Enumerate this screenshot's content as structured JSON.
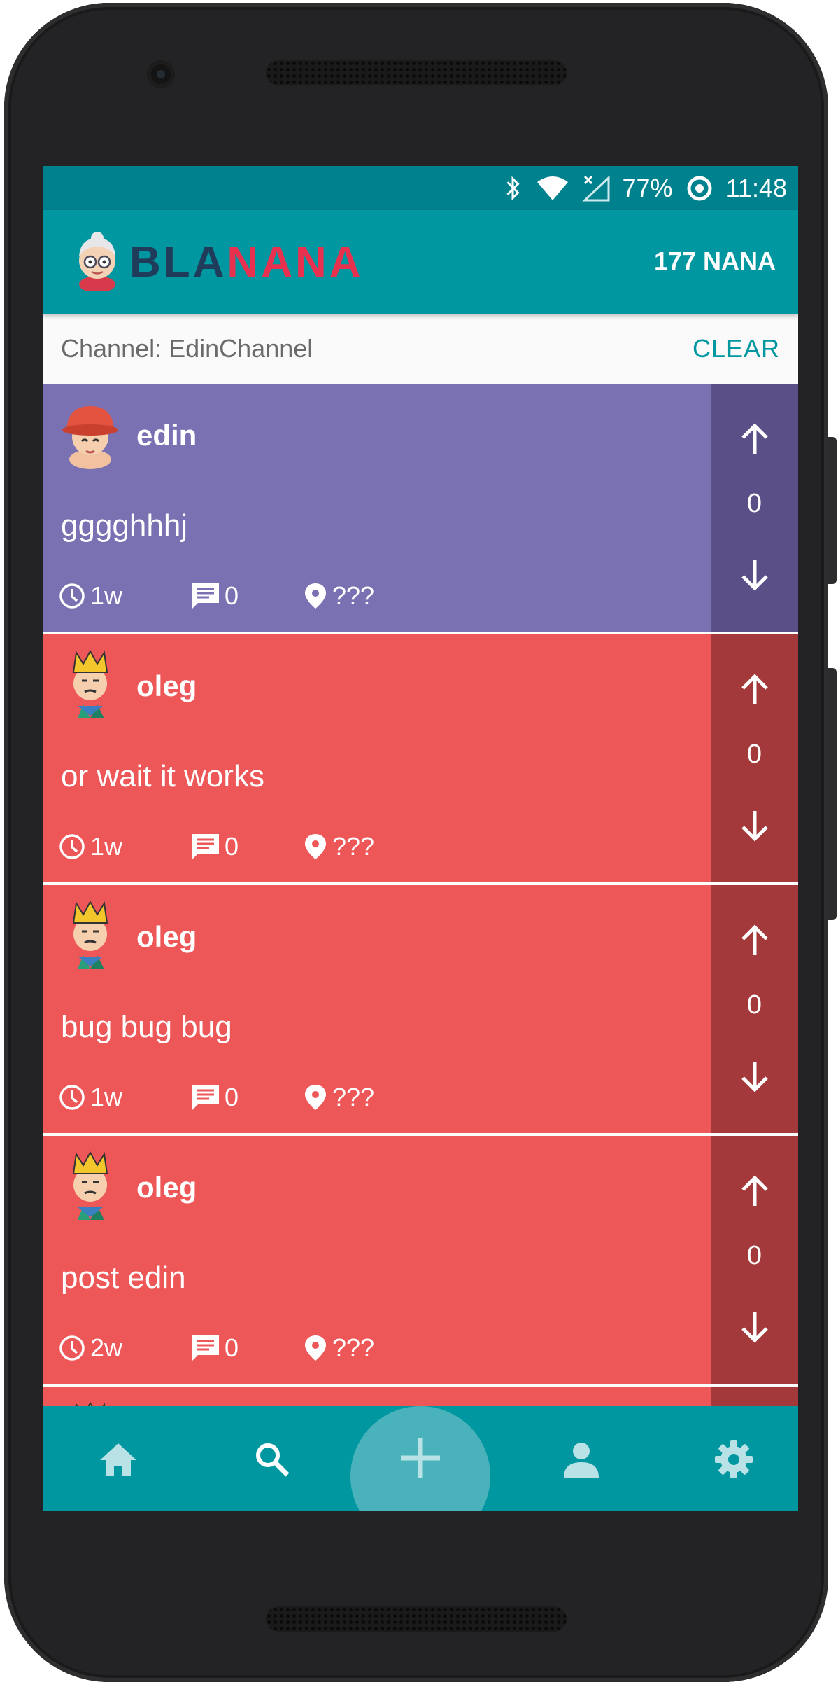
{
  "status_bar": {
    "battery": "77%",
    "time": "11:48",
    "icons": [
      "bluetooth-icon",
      "wifi-icon",
      "no-signal-icon",
      "data-saver-icon"
    ]
  },
  "app_bar": {
    "logo_text_part1": "BLA",
    "logo_text_part2": "NANA",
    "balance": "177 NANA"
  },
  "channel_bar": {
    "label": "Channel: EdinChannel",
    "clear_label": "CLEAR"
  },
  "colors": {
    "primary": "#0097a1",
    "status_bar": "#00818e",
    "purple_post": "#7a71b3",
    "purple_vote": "#5a4f86",
    "red_post": "#ed5758",
    "red_vote": "#a3393a",
    "logo_dark": "#1f3c5b",
    "logo_pink": "#e8304f"
  },
  "posts": [
    {
      "username": "edin",
      "text": "gggghhhj",
      "age": "1w",
      "comments": "0",
      "location": "???",
      "votes": "0",
      "theme": "purple",
      "avatar": "red-hat-avatar-icon"
    },
    {
      "username": "oleg",
      "text": "or wait it works",
      "age": "1w",
      "comments": "0",
      "location": "???",
      "votes": "0",
      "theme": "red",
      "avatar": "king-avatar-icon"
    },
    {
      "username": "oleg",
      "text": "bug bug bug",
      "age": "1w",
      "comments": "0",
      "location": "???",
      "votes": "0",
      "theme": "red",
      "avatar": "king-avatar-icon"
    },
    {
      "username": "oleg",
      "text": "post edin",
      "age": "2w",
      "comments": "0",
      "location": "???",
      "votes": "0",
      "theme": "red",
      "avatar": "king-avatar-icon"
    }
  ],
  "bottom_nav": {
    "items": [
      "home-icon",
      "search-icon",
      "add-icon",
      "profile-icon",
      "settings-icon"
    ]
  }
}
